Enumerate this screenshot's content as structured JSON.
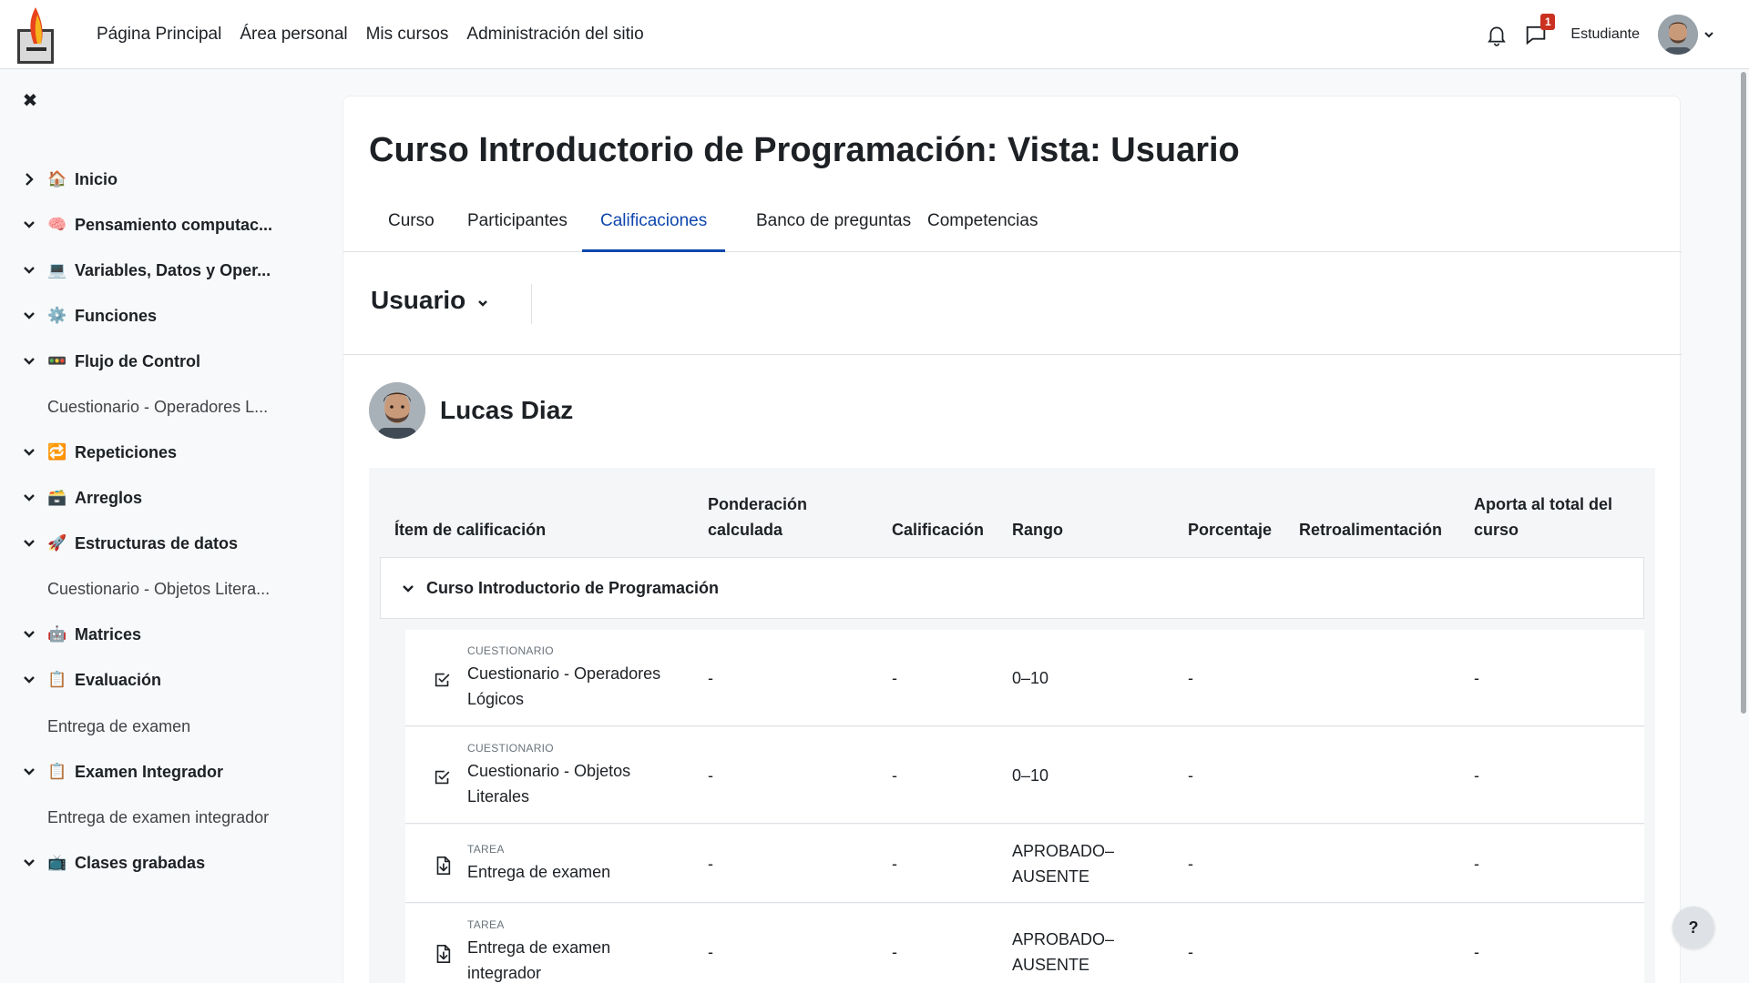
{
  "navbar": {
    "links": [
      "Página Principal",
      "Área personal",
      "Mis cursos",
      "Administración del sitio"
    ],
    "message_count": "1",
    "role": "Estudiante"
  },
  "sidebar": {
    "items": [
      {
        "type": "section",
        "label": "Inicio",
        "icon": "house-icon",
        "emoji": "🏠",
        "expanded": false
      },
      {
        "type": "section",
        "label": "Pensamiento computac...",
        "icon": "brain-icon",
        "emoji": "🧠",
        "expanded": true
      },
      {
        "type": "section",
        "label": "Variables, Datos y Oper...",
        "icon": "laptop-icon",
        "emoji": "💻",
        "expanded": true
      },
      {
        "type": "section",
        "label": "Funciones",
        "icon": "gear-icon",
        "emoji": "⚙️",
        "expanded": true
      },
      {
        "type": "section",
        "label": "Flujo de Control",
        "icon": "traffic-light-icon",
        "emoji": "🚥",
        "expanded": true
      },
      {
        "type": "activity",
        "label": "Cuestionario - Operadores L..."
      },
      {
        "type": "section",
        "label": "Repeticiones",
        "icon": "repeat-icon",
        "emoji": "🔁",
        "expanded": true
      },
      {
        "type": "section",
        "label": "Arreglos",
        "icon": "package-icon",
        "emoji": "🗃️",
        "expanded": true
      },
      {
        "type": "section",
        "label": "Estructuras de datos",
        "icon": "rocket-icon",
        "emoji": "🚀",
        "expanded": true
      },
      {
        "type": "activity",
        "label": "Cuestionario - Objetos Litera..."
      },
      {
        "type": "section",
        "label": "Matrices",
        "icon": "robot-icon",
        "emoji": "🤖",
        "expanded": true
      },
      {
        "type": "section",
        "label": "Evaluación",
        "icon": "clipboard-icon",
        "emoji": "📋",
        "expanded": true
      },
      {
        "type": "activity",
        "label": "Entrega de examen"
      },
      {
        "type": "section",
        "label": "Examen Integrador",
        "icon": "clipboard-icon",
        "emoji": "📋",
        "expanded": true
      },
      {
        "type": "activity",
        "label": "Entrega de examen integrador"
      },
      {
        "type": "section",
        "label": "Clases grabadas",
        "icon": "tv-icon",
        "emoji": "📺",
        "expanded": true
      }
    ]
  },
  "page": {
    "title": "Curso Introductorio de Programación: Vista: Usuario",
    "tabs": [
      "Curso",
      "Participantes",
      "Calificaciones",
      "Banco de preguntas",
      "Competencias"
    ],
    "active_tab": "Calificaciones",
    "view_selector": "Usuario",
    "user_name": "Lucas Diaz"
  },
  "grades": {
    "headers": {
      "item": "Ítem de calificación",
      "weight_line1": "Ponderación",
      "weight_line2": "calculada",
      "grade": "Calificación",
      "range": "Rango",
      "percentage": "Porcentaje",
      "feedback": "Retroalimentación",
      "contrib_line1": "Aporta al total del",
      "contrib_line2": "curso"
    },
    "category": "Curso Introductorio de Programación",
    "rows": [
      {
        "type": "CUESTIONARIO",
        "name_line1": "Cuestionario - Operadores",
        "name_line2": "Lógicos",
        "weight": "-",
        "grade": "-",
        "range_line1": "0–10",
        "range_line2": "",
        "percentage": "-",
        "contribution": "-",
        "icon": "quiz-icon"
      },
      {
        "type": "CUESTIONARIO",
        "name_line1": "Cuestionario - Objetos",
        "name_line2": "Literales",
        "weight": "-",
        "grade": "-",
        "range_line1": "0–10",
        "range_line2": "",
        "percentage": "-",
        "contribution": "-",
        "icon": "quiz-icon"
      },
      {
        "type": "TAREA",
        "name_line1": "Entrega de examen",
        "name_line2": "",
        "weight": "-",
        "grade": "-",
        "range_line1": "APROBADO–",
        "range_line2": "AUSENTE",
        "percentage": "-",
        "contribution": "-",
        "icon": "assignment-icon"
      },
      {
        "type": "TAREA",
        "name_line1": "Entrega de examen",
        "name_line2": "integrador",
        "weight": "-",
        "grade": "-",
        "range_line1": "APROBADO–",
        "range_line2": "AUSENTE",
        "percentage": "-",
        "contribution": "-",
        "icon": "assignment-icon"
      }
    ]
  },
  "help_label": "?",
  "colors": {
    "accent": "#0f47ad",
    "badge": "#ca3120",
    "text": "#1d2125",
    "border": "#dee2e6"
  }
}
